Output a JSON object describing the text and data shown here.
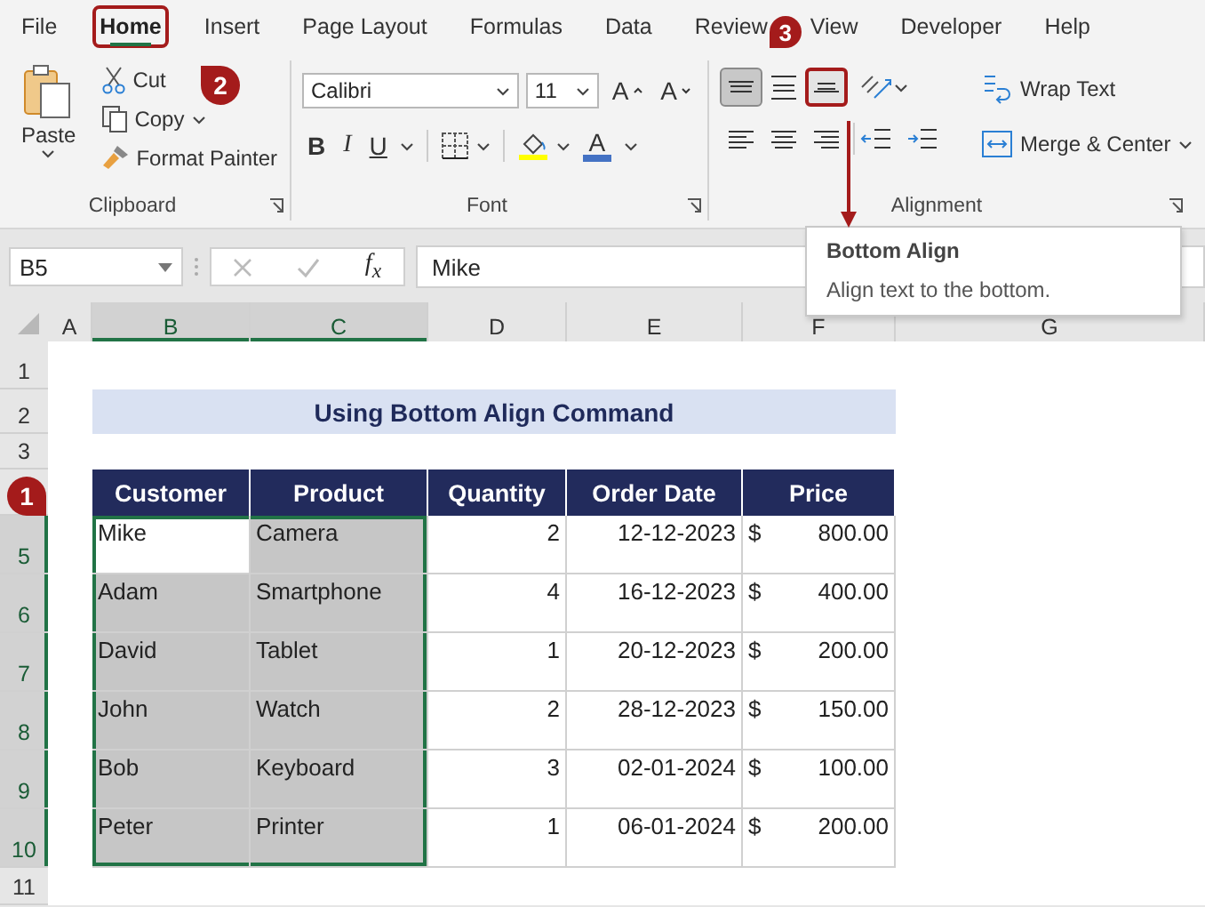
{
  "tabs": [
    {
      "label": "File",
      "selected": false,
      "highlighted": false
    },
    {
      "label": "Home",
      "selected": true,
      "highlighted": true
    },
    {
      "label": "Insert",
      "selected": false,
      "highlighted": false
    },
    {
      "label": "Page Layout",
      "selected": false,
      "highlighted": false
    },
    {
      "label": "Formulas",
      "selected": false,
      "highlighted": false
    },
    {
      "label": "Data",
      "selected": false,
      "highlighted": false
    },
    {
      "label": "Review",
      "selected": false,
      "highlighted": false
    },
    {
      "label": "View",
      "selected": false,
      "highlighted": false
    },
    {
      "label": "Developer",
      "selected": false,
      "highlighted": false
    },
    {
      "label": "Help",
      "selected": false,
      "highlighted": false
    }
  ],
  "ribbon": {
    "clipboard": {
      "paste": "Paste",
      "cut": "Cut",
      "copy": "Copy",
      "format_painter": "Format Painter",
      "label": "Clipboard"
    },
    "font": {
      "name": "Calibri",
      "size": "11",
      "grow": "A",
      "shrink": "A",
      "bold": "B",
      "italic": "I",
      "underline": "U",
      "font_color": "A",
      "label": "Font"
    },
    "alignment": {
      "vertical": [
        {
          "kind": "top",
          "selected": true,
          "highlighted": false
        },
        {
          "kind": "middle",
          "selected": false,
          "highlighted": false
        },
        {
          "kind": "bottom",
          "selected": false,
          "highlighted": true
        }
      ],
      "horizontal": [
        {
          "kind": "left"
        },
        {
          "kind": "center"
        },
        {
          "kind": "right"
        }
      ],
      "wrap_text": "Wrap Text",
      "merge_center": "Merge & Center",
      "label": "Alignment"
    }
  },
  "formula_bar": {
    "name_box": "B5",
    "fx": "f$_{x}$",
    "value": "Mike"
  },
  "sheet": {
    "columns": [
      {
        "label": "A",
        "selected": false
      },
      {
        "label": "B",
        "selected": true
      },
      {
        "label": "C",
        "selected": true
      },
      {
        "label": "D",
        "selected": false
      },
      {
        "label": "E",
        "selected": false
      },
      {
        "label": "F",
        "selected": false
      },
      {
        "label": "G",
        "selected": false
      }
    ],
    "rows": [
      {
        "label": "1",
        "selected": false
      },
      {
        "label": "2",
        "selected": false
      },
      {
        "label": "3",
        "selected": false
      },
      {
        "selected": false
      },
      {
        "label": "5",
        "selected": true
      },
      {
        "label": "6",
        "selected": true
      },
      {
        "label": "7",
        "selected": true
      },
      {
        "label": "8",
        "selected": true
      },
      {
        "label": "9",
        "selected": true
      },
      {
        "label": "10",
        "selected": true
      },
      {
        "label": "11",
        "selected": false
      }
    ],
    "title": "Using Bottom Align Command",
    "table": {
      "headers": [
        "Customer",
        "Product",
        "Quantity",
        "Order Date",
        "Price"
      ],
      "rows": [
        {
          "customer": "Mike",
          "product": "Camera",
          "quantity": "2",
          "order_date": "12-12-2023",
          "currency": "$",
          "price": "800.00",
          "active": true
        },
        {
          "customer": "Adam",
          "product": "Smartphone",
          "quantity": "4",
          "order_date": "16-12-2023",
          "currency": "$",
          "price": "400.00",
          "active": false
        },
        {
          "customer": "David",
          "product": "Tablet",
          "quantity": "1",
          "order_date": "20-12-2023",
          "currency": "$",
          "price": "200.00",
          "active": false
        },
        {
          "customer": "John",
          "product": "Watch",
          "quantity": "2",
          "order_date": "28-12-2023",
          "currency": "$",
          "price": "150.00",
          "active": false
        },
        {
          "customer": "Bob",
          "product": "Keyboard",
          "quantity": "3",
          "order_date": "02-01-2024",
          "currency": "$",
          "price": "100.00",
          "active": false
        },
        {
          "customer": "Peter",
          "product": "Printer",
          "quantity": "1",
          "order_date": "06-01-2024",
          "currency": "$",
          "price": "200.00",
          "active": false
        }
      ]
    }
  },
  "tooltip": {
    "title": "Bottom Align",
    "text": "Align text to the bottom."
  },
  "callouts": [
    {
      "number": "1"
    },
    {
      "number": "2"
    },
    {
      "number": "3"
    }
  ]
}
